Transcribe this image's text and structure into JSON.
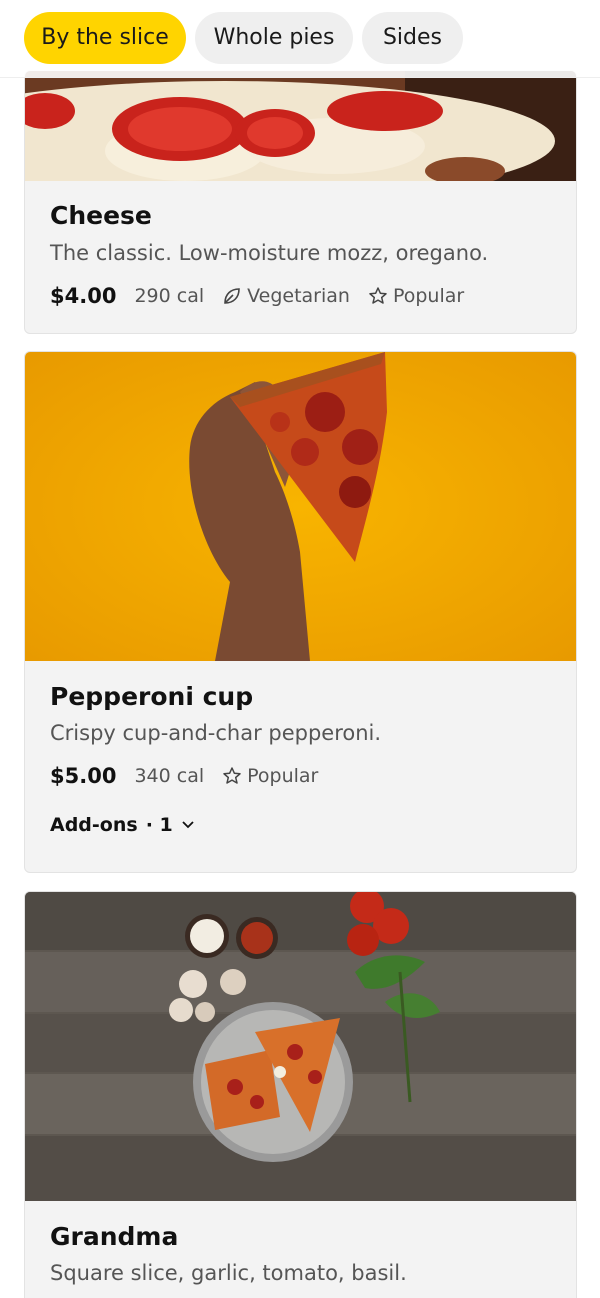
{
  "tabs": [
    {
      "label": "By the slice",
      "active": true
    },
    {
      "label": "Whole pies",
      "active": false
    },
    {
      "label": "Sides",
      "active": false
    }
  ],
  "items": [
    {
      "name": "Cheese",
      "description": "The classic. Low-moisture mozz, oregano.",
      "price": "$4.00",
      "calories": "290 cal",
      "tags": [
        {
          "icon": "leaf-icon",
          "label": "Vegetarian"
        },
        {
          "icon": "star-icon",
          "label": "Popular"
        }
      ]
    },
    {
      "name": "Pepperoni cup",
      "description": "Crispy cup-and-char pepperoni.",
      "price": "$5.00",
      "calories": "340 cal",
      "tags": [
        {
          "icon": "star-icon",
          "label": "Popular"
        }
      ],
      "addons_label": "Add-ons",
      "addons_count": "· 1"
    },
    {
      "name": "Grandma",
      "description": "Square slice, garlic, tomato, basil."
    }
  ],
  "colors": {
    "accent": "#ffd400",
    "card_bg": "#f3f3f3",
    "pepperoni_photo_bg": "#f5a800"
  }
}
